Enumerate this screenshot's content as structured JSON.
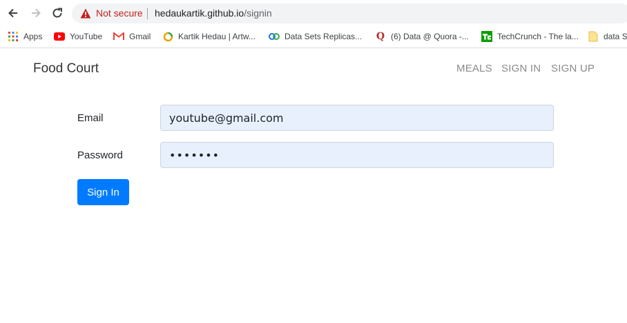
{
  "browser": {
    "security_label": "Not secure",
    "url_host": "hedaukartik.github.io",
    "url_path": "/signin",
    "icons": {
      "back": "back-arrow-icon",
      "forward": "forward-arrow-icon",
      "reload": "reload-icon",
      "warning": "warning-triangle-icon"
    },
    "colors": {
      "warning": "#c5221f",
      "omnibox_bg": "#f1f3f4"
    }
  },
  "bookmarks": [
    {
      "label": "Apps",
      "icon": "apps-grid-icon"
    },
    {
      "label": "YouTube",
      "icon": "youtube-icon"
    },
    {
      "label": "Gmail",
      "icon": "gmail-icon"
    },
    {
      "label": "Kartik Hedau | Artw...",
      "icon": "ring-icon"
    },
    {
      "label": "Data Sets Replicas...",
      "icon": "circles-icon"
    },
    {
      "label": "(6) Data @ Quora -...",
      "icon": "quora-icon"
    },
    {
      "label": "TechCrunch - The la...",
      "icon": "techcrunch-icon"
    },
    {
      "label": "data S",
      "icon": "folder-icon"
    }
  ],
  "navbar": {
    "brand": "Food Court",
    "links": [
      "MEALS",
      "SIGN IN",
      "SIGN UP"
    ]
  },
  "form": {
    "email_label": "Email",
    "email_value": "youtube@gmail.com",
    "password_label": "Password",
    "password_value": "•••••••",
    "submit_label": "Sign In",
    "colors": {
      "button": "#007bff",
      "autofill_bg": "#e8f0fe"
    }
  }
}
